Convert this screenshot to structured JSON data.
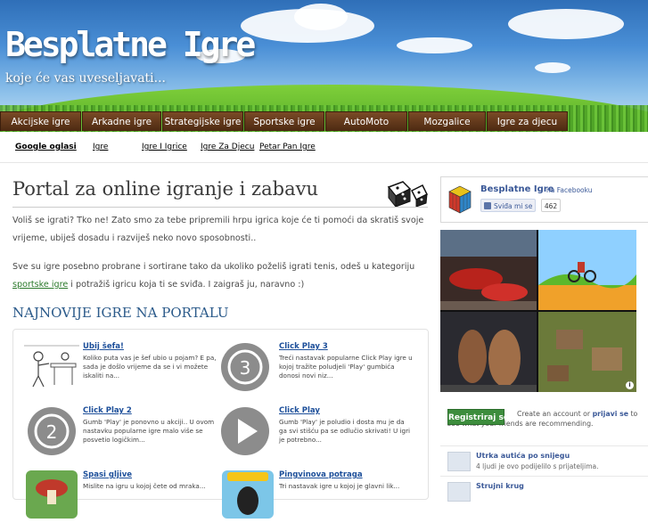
{
  "header": {
    "title": "Besplatne Igre",
    "tagline": "koje će vas uveseljavati..."
  },
  "main_nav": [
    {
      "label": "Akcijske igre"
    },
    {
      "label": "Arkadne igre"
    },
    {
      "label": "Strategijske igre"
    },
    {
      "label": "Sportske igre"
    },
    {
      "label": "AutoMoto"
    },
    {
      "label": "Mozgalice"
    },
    {
      "label": "Igre za djecu"
    }
  ],
  "sub_nav": [
    {
      "label": "Google oglasi"
    },
    {
      "label": "Igre"
    },
    {
      "label": "Igre I Igrice"
    },
    {
      "label": "Igre Za Djecu"
    },
    {
      "label": "Petar Pan Igre"
    }
  ],
  "main": {
    "heading": "Portal za online igranje i zabavu",
    "para1": "Voliš se igrati? Tko ne! Zato smo za tebe pripremili hrpu igrica koje će ti pomoći da skratiš svoje vrijeme, ubiješ dosadu i razviješ neko novo sposobnosti..",
    "para2_before": "Sve su igre posebno probrane i sortirane tako da ukoliko poželiš igrati tenis, odeš u kategoriju ",
    "para2_link": "sportske igre",
    "para2_after": " i potražiš igricu koja ti se sviđa. I zaigraš ju, naravno :)",
    "section_heading": "NAJNOVIJE IGRE NA PORTALU"
  },
  "games": [
    {
      "title": "Ubij šefa!",
      "desc": "Koliko puta vas je šef ubio u pojam? E pa, sada je došlo vrijeme da se i vi možete iskaliti na...",
      "icon": "stick-figure-thumb"
    },
    {
      "title": "Click Play 3",
      "desc": "Treći nastavak popularne Click Play igre u kojoj tražite poludjeli 'Play' gumbića donosi novi niz...",
      "icon": "play-3-icon"
    },
    {
      "title": "Click Play 2",
      "desc": "Gumb 'Play' je ponovno u akciji.. U ovom nastavku popularne igre malo više se posvetio logičkim...",
      "icon": "play-2-icon"
    },
    {
      "title": "Click Play",
      "desc": "Gumb 'Play' je poludio i dosta mu je da ga svi stišću pa se odlučio skrivati! U igri je potrebno...",
      "icon": "play-icon"
    },
    {
      "title": "Spasi gljive",
      "desc": "Mislite na igru u kojoj čete od mraka...",
      "icon": "mushroom-thumb"
    },
    {
      "title": "Pingvinova potraga",
      "desc": "Tri nastavak igre u kojoj je glavni lik...",
      "icon": "penguin-thumb"
    }
  ],
  "facebook": {
    "name": "Besplatne Igre",
    "suffix": "na Facebooku",
    "like_label": "Sviđa mi se",
    "like_count": "462"
  },
  "signup": {
    "button": "Registriraj se",
    "text_before": "Create an account or ",
    "link": "prijavi se",
    "text_after": " to see what your friends are recommending."
  },
  "activity": [
    {
      "title": "Utrka autića po snijegu",
      "text": "4 ljudi je ovo podijelilo s prijateljima."
    },
    {
      "title": "Strujni krug",
      "text": ""
    }
  ],
  "colors": {
    "nav_brown": "#5a3216",
    "heading_blue": "#2b5a8a",
    "link_green": "#2c7a2c",
    "fb_blue": "#3b5998",
    "register_green": "#3d8d3d"
  }
}
